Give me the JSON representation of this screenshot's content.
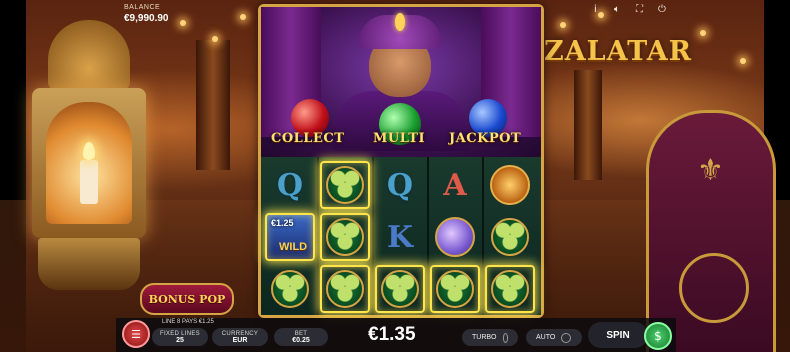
{
  "balance": {
    "label": "BALANCE",
    "value": "€9,990.90"
  },
  "top_controls": {
    "info": "i",
    "sound_icon": "speaker-icon",
    "fullscreen_icon": "fullscreen-icon",
    "power_icon": "power-icon"
  },
  "logo": "ZALATAR",
  "features": {
    "collect": "COLLECT",
    "multi": "MULTI",
    "jackpot": "JACKPOT"
  },
  "reels": [
    [
      "Q",
      "clover",
      "clover"
    ],
    [
      "clover",
      "clover",
      "clover"
    ],
    [
      "Q",
      "K",
      "clover"
    ],
    [
      "A",
      "moon",
      "clover"
    ],
    [
      "sun",
      "clover",
      "clover"
    ]
  ],
  "wild": {
    "value": "€1.25",
    "label": "WILD"
  },
  "bonus_pop": "BONUS POP",
  "bottom": {
    "payline_text": "LINE 8 PAYS €1.25",
    "fixed_lines_label": "FIXED LINES",
    "fixed_lines_value": "25",
    "currency_label": "CURRENCY",
    "currency_value": "EUR",
    "bet_label": "BET",
    "bet_value": "€0.25",
    "win": "€1.35",
    "turbo": "TURBO",
    "auto": "AUTO",
    "spin": "SPIN"
  },
  "colors": {
    "gold": "#d5a444",
    "highlight": "#ffe44a",
    "bar": "#0a0a0e"
  }
}
